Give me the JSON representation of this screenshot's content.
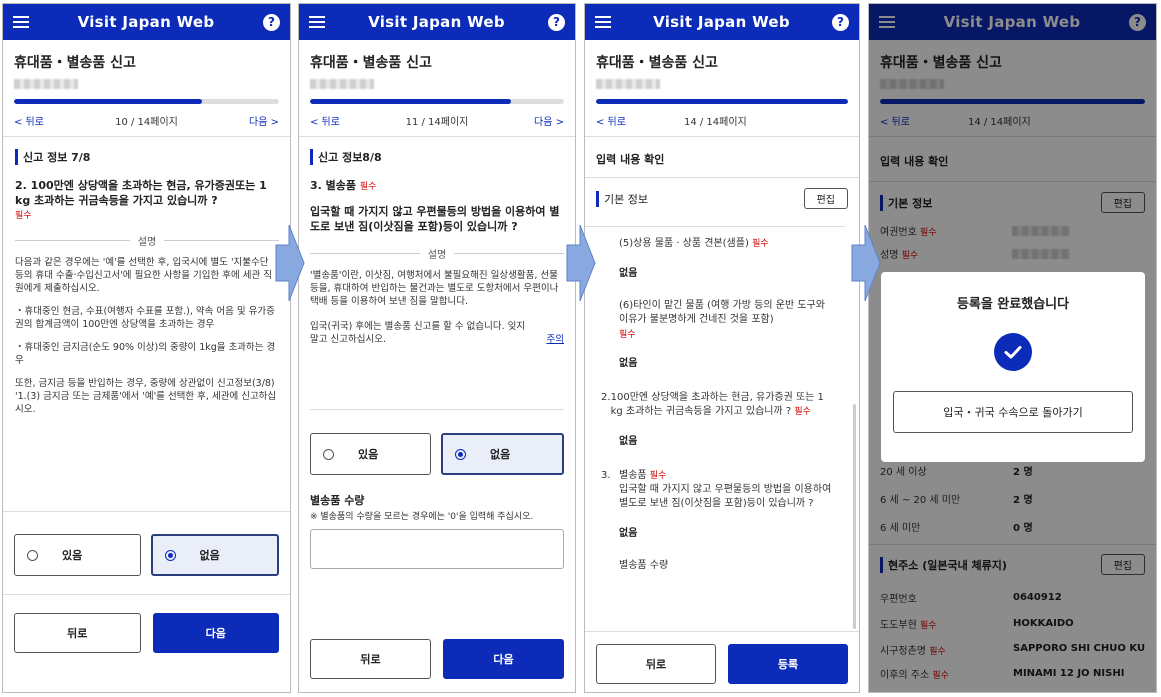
{
  "app_title": "Visit Japan Web",
  "page_heading": "휴대품・별송품 신고",
  "nav": {
    "prev": "< 뒤로",
    "next": "다음 >"
  },
  "panel1": {
    "page_indicator": "10 / 14페이지",
    "progress": 0.71,
    "section": "신고 정보 7/8",
    "question": "2. 100만엔 상당액을 초과하는 현금, 유가증권또는 1 kg 초과하는 귀금속등을 가지고 있습니까 ?",
    "required": "필수",
    "explain_label": "설명",
    "paragraphs": [
      "다음과 같은 경우에는 '예'를 선택한 후, 입국시에 별도 '지불수단 등의 휴대 수출·수입신고서'에 필요한 사항을 기입한 후에 세관 직원에게 제출하십시오.",
      "・휴대중인 현금, 수표(여행자 수표를 포함.), 약속 어음 및 유가증권의 합계금액이 100만엔 상당액을 초과하는 경우",
      "・휴대중인 금지금(순도 90% 이상)의 중량이 1kg을 초과하는 경우",
      "또한, 금지금 등을 반입하는 경우, 중량에 상관없이 신고정보(3/8) '1.(3) 금지금 또는 금제품'에서 '예'를 선택한 후, 세관에 신고하십시오."
    ],
    "option_yes": "있음",
    "option_no": "없음",
    "back": "뒤로",
    "next": "다음"
  },
  "panel2": {
    "page_indicator": "11 / 14페이지",
    "progress": 0.79,
    "section": "신고 정보8/8",
    "q_title": "3. 별송품",
    "required": "필수",
    "question": "입국할 때 가지지 않고 우편물등의 방법을 이용하여 별도로 보낸 짐(이삿짐을 포함)등이 있습니까 ?",
    "explain_label": "설명",
    "para1": "'별송품'이란, 이삿짐, 여행처에서 불필요해진 일상생활품, 선물 등을, 휴대하여 반입하는 물건과는 별도로 도항처에서 우편이나 택배 등을 이용하여 보낸 짐을 말합니다.",
    "para2": "입국(귀국) 후에는 별송품 신고를 할 수 없습니다. 잊지 말고 신고하십시오.",
    "link": "주의",
    "option_yes": "있음",
    "option_no": "없음",
    "qty_label": "별송품 수량",
    "qty_note": "※ 별송품의 수량을 모르는 경우에는 '0'을 입력해 주십시오.",
    "back": "뒤로",
    "next": "다음"
  },
  "panel3": {
    "page_indicator": "14 / 14페이지",
    "progress": 1.0,
    "confirm": "입력 내용 확인",
    "basic_info": "기본 정보",
    "edit": "편집",
    "item5": "(5)상용 물품 · 상품 견본(샘플)",
    "item6": "(6)타인이 맡긴 물품 (여행 가방 등의 운반 도구와 이유가 불분명하게 건네진 것을 포함)",
    "q2": "100만엔 상당액을 초과하는 현금, 유가증권 또는 1 kg 초과하는 귀금속등을 가지고 있습니까 ?",
    "q3_title": "별송품",
    "q3": "입국할 때 가지지 않고 우편물등의 방법을 이용하여 별도로 보낸 짐(이삿짐을 포함)등이 있습니까 ?",
    "answer_no": "없음",
    "qty_label": "별송품 수량",
    "required": "필수",
    "back": "뒤로",
    "register": "등록"
  },
  "panel4": {
    "page_indicator": "14 / 14페이지",
    "progress": 1.0,
    "confirm": "입력 내용 확인",
    "basic_info": "기본 정보",
    "edit": "편집",
    "passport_label": "여권번호",
    "name_label": "성명",
    "required": "필수",
    "dialog_title": "등록을 완료했습니다",
    "dialog_button": "입국・귀국 수속으로 돌아가기",
    "family": [
      {
        "label": "20 세 이상",
        "value": "2 명"
      },
      {
        "label": "6 세 ~ 20 세 미만",
        "value": "2 명"
      },
      {
        "label": "6 세 미만",
        "value": "0 명"
      }
    ],
    "address_title": "현주소 (일본국내 체류지)",
    "address": [
      {
        "label": "우편번호",
        "value": "0640912",
        "req": false
      },
      {
        "label": "도도부현",
        "value": "HOKKAIDO",
        "req": true
      },
      {
        "label": "시구정촌명",
        "value": "SAPPORO SHI CHUO KU",
        "req": true
      },
      {
        "label": "이후의 주소",
        "value": "MINAMI 12 JO NISHI",
        "req": true
      }
    ]
  },
  "colors": {
    "primary": "#0b2bb8",
    "required": "#d20000",
    "arrow": "#8aa8e0"
  }
}
